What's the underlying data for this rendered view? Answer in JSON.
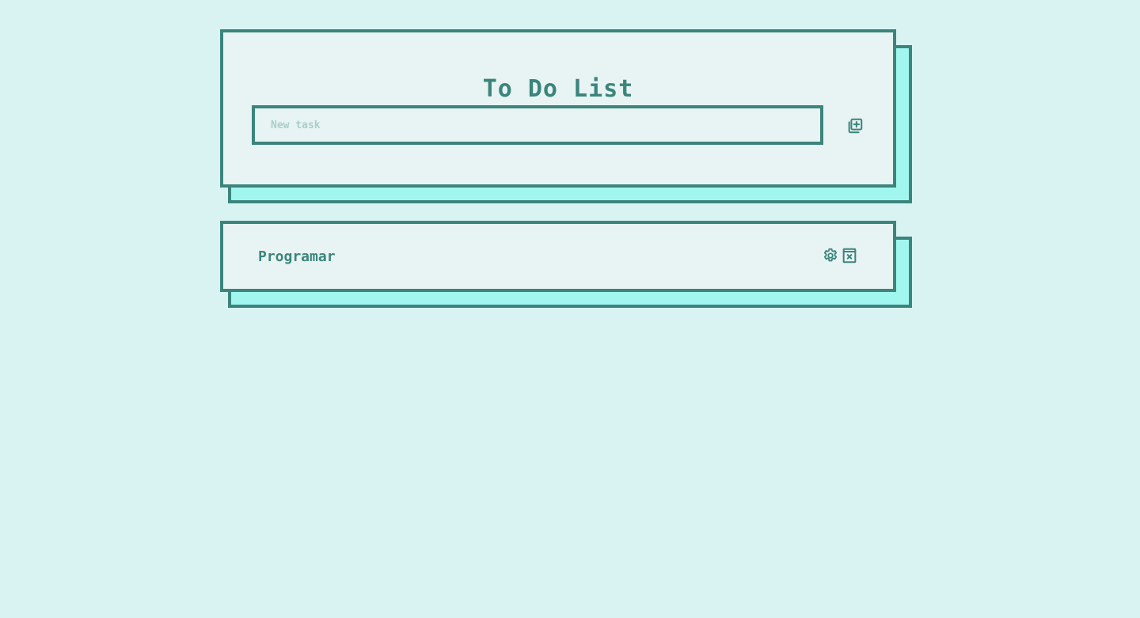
{
  "app": {
    "title": "To Do List"
  },
  "new_task": {
    "placeholder": "New task",
    "value": "",
    "add_icon": "add-box-icon"
  },
  "tasks": [
    {
      "label": "Programar",
      "settings_icon": "gear-icon",
      "delete_icon": "delete-box-icon"
    }
  ],
  "colors": {
    "background": "#d9f3f3",
    "card": "#e8f3f3",
    "shadow": "#a1f7f0",
    "accent": "#3b857c",
    "placeholder": "#a9cfcb"
  }
}
